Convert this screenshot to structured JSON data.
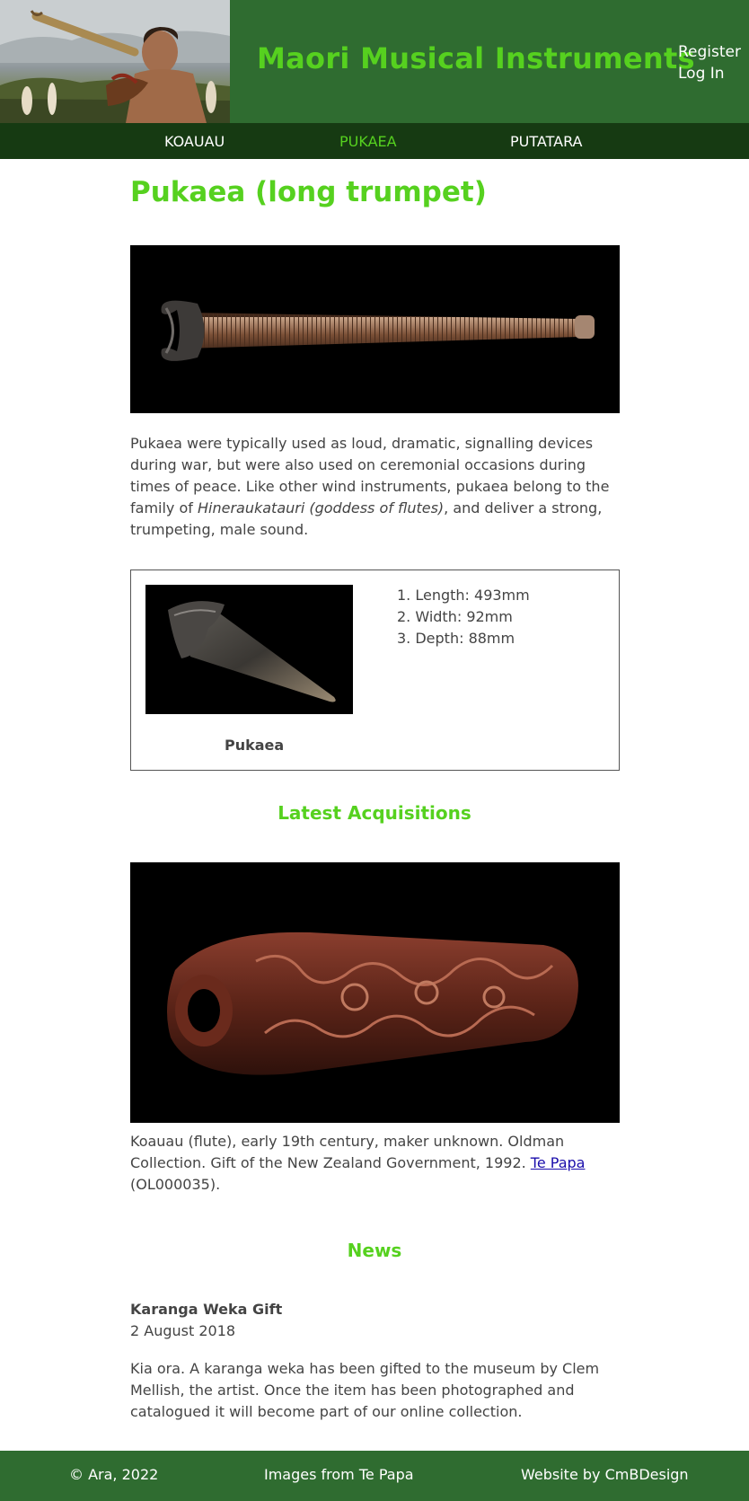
{
  "header": {
    "hero_image": "man-blowing-pukaea-photo",
    "site_title": "Maori Musical Instruments",
    "auth": {
      "register": "Register",
      "login": "Log In"
    }
  },
  "nav": {
    "items": [
      {
        "label": "KOAUAU",
        "active": false
      },
      {
        "label": "PUKAEA",
        "active": true
      },
      {
        "label": "PUTATARA",
        "active": false
      }
    ]
  },
  "main": {
    "title": "Pukaea (long trumpet)",
    "hero_image": "pukaea-long-trumpet-photo",
    "intro": {
      "text_before": "Pukaea were typically used as loud, dramatic, signalling devices during war, but were also used on ceremonial occasions during times of peace. Like other wind instruments, pukaea belong to the family of ",
      "text_italic": "Hineraukatauri (goddess of flutes)",
      "text_after": ", and deliver a strong, trumpeting, male sound."
    },
    "specs": {
      "image": "pukaea-photo",
      "caption": "Pukaea",
      "items": [
        "1. Length: 493mm",
        "2. Width: 92mm",
        "3. Depth: 88mm"
      ]
    }
  },
  "acquisitions": {
    "title": "Latest Acquisitions",
    "image": "koauau-flute-photo",
    "caption_before": "Koauau (flute), early 19th century, maker unknown. Oldman Collection. Gift of the New Zealand Government, 1992. ",
    "link_text": "Te Papa",
    "caption_after": " (OL000035)."
  },
  "news": {
    "title": "News",
    "item_title": "Karanga Weka Gift",
    "item_date": "2 August 2018",
    "item_body": "Kia ora. A karanga weka has been gifted to the museum by Clem Mellish, the artist. Once the item has been photographed and catalogued it will become part of our online collection."
  },
  "footer": {
    "copyright": "© Ara, 2022",
    "images_credit": "Images from Te Papa",
    "design_credit": "Website by CmBDesign"
  },
  "colors": {
    "header_green": "#2f6c30",
    "nav_dark_green": "#163a12",
    "accent_green": "#56d11f",
    "text": "#444444",
    "link": "#1a0dab"
  }
}
